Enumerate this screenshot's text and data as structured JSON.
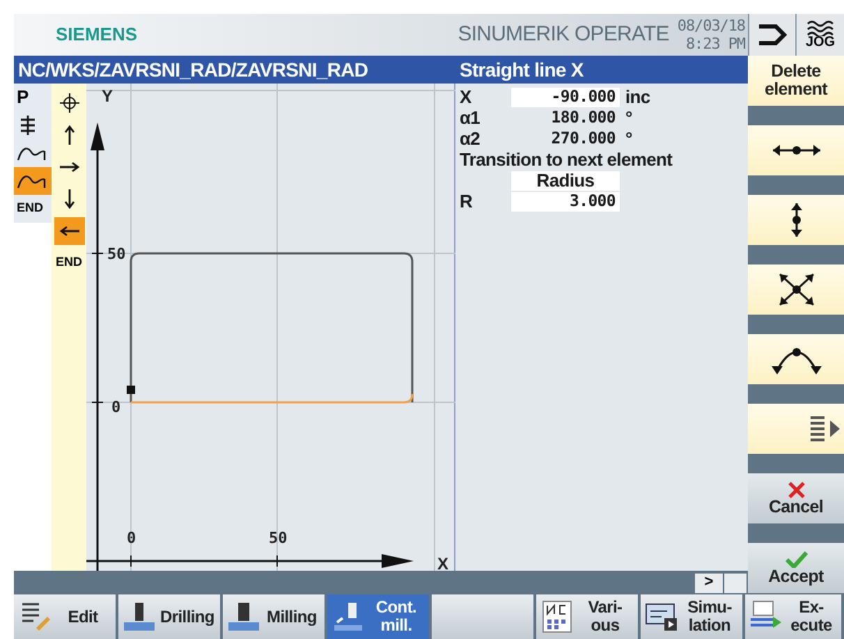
{
  "header": {
    "brand": "SIEMENS",
    "product": "SINUMERIK OPERATE",
    "date": "08/03/18",
    "time": "8:23 PM",
    "mode": "JOG"
  },
  "path_title": "NC/WKS/ZAVRSNI_RAD/ZAVRSNI_RAD",
  "param_title": "Straight line X",
  "contour_tree": [
    {
      "kind": "text",
      "label": "P",
      "selected": false
    },
    {
      "kind": "sync",
      "selected": false
    },
    {
      "kind": "contour",
      "selected": false
    },
    {
      "kind": "contour",
      "selected": true
    },
    {
      "kind": "text",
      "label": "END",
      "selected": false
    }
  ],
  "element_list": [
    {
      "kind": "start",
      "selected": false
    },
    {
      "kind": "up",
      "selected": false
    },
    {
      "kind": "right",
      "selected": false
    },
    {
      "kind": "down",
      "selected": false
    },
    {
      "kind": "left",
      "selected": true
    },
    {
      "kind": "text",
      "label": "END",
      "selected": false
    }
  ],
  "graphic": {
    "x_axis_label": "X",
    "y_axis_label": "Y",
    "x_ticks": [
      "0",
      "50"
    ],
    "y_ticks": [
      "50",
      "0"
    ]
  },
  "params": [
    {
      "kind": "field",
      "label": "X",
      "value": "-90.000",
      "unit": "inc"
    },
    {
      "kind": "value",
      "label": "α1",
      "value": "180.000",
      "unit": "°"
    },
    {
      "kind": "value",
      "label": "α2",
      "value": "270.000",
      "unit": "°"
    },
    {
      "kind": "heading",
      "label": "Transition to next element"
    },
    {
      "kind": "select",
      "value": "Radius"
    },
    {
      "kind": "field",
      "label": "R",
      "value": "3.000"
    }
  ],
  "vertical_softkeys": [
    {
      "kind": "text",
      "label": "Delete element"
    },
    {
      "kind": "horizontal"
    },
    {
      "kind": "vertical"
    },
    {
      "kind": "diagonal"
    },
    {
      "kind": "arc"
    },
    {
      "kind": "more"
    },
    {
      "kind": "cancel",
      "label": "Cancel"
    },
    {
      "kind": "accept",
      "label": "Accept"
    }
  ],
  "scroll_button": ">",
  "bottom_softkeys": [
    {
      "kind": "edit",
      "label": "Edit",
      "selected": false
    },
    {
      "kind": "drill",
      "label": "Drilling",
      "selected": false
    },
    {
      "kind": "mill",
      "label": "Milling",
      "selected": false
    },
    {
      "kind": "contour",
      "label": "Cont. mill.",
      "selected": true
    },
    {
      "kind": "blank",
      "selected": false
    },
    {
      "kind": "various",
      "label": "Vari- ous",
      "selected": false
    },
    {
      "kind": "simulation",
      "label": "Simu- lation",
      "selected": false
    },
    {
      "kind": "execute",
      "label": "Ex- ecute",
      "selected": false
    }
  ]
}
